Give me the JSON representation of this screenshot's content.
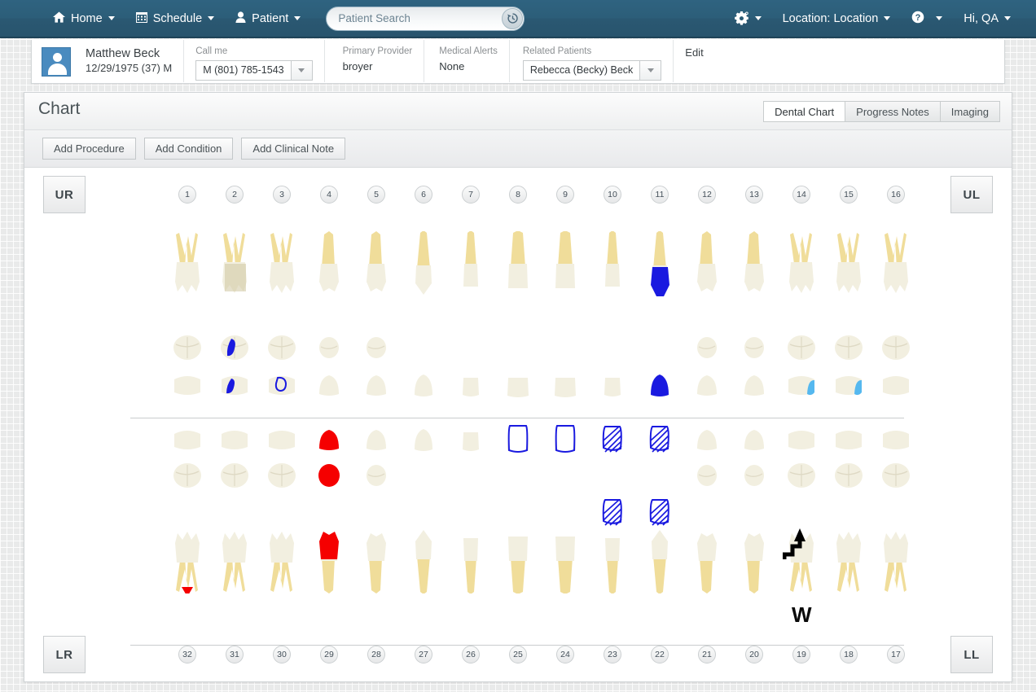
{
  "topnav": {
    "items": [
      {
        "label": "Home",
        "icon": "home-icon",
        "caret": true
      },
      {
        "label": "Schedule",
        "icon": "calendar-icon",
        "caret": true
      },
      {
        "label": "Patient",
        "icon": "person-icon",
        "caret": true
      }
    ],
    "search": {
      "placeholder": "Patient Search",
      "value": "",
      "history_icon": "history-clock-icon"
    },
    "right": {
      "gear_icon": "gear-icon",
      "location_label": "Location: Location",
      "help_icon": "help-circle-icon",
      "user_label": "Hi,  QA"
    },
    "bg_color": "#2b5b75"
  },
  "patient_bar": {
    "avatar_icon": "avatar-icon",
    "name": "Matthew Beck",
    "dob_line": "12/29/1975 (37) M",
    "call_me": {
      "label": "Call me",
      "value": "M (801) 785-1543"
    },
    "primary_provider": {
      "label": "Primary Provider",
      "value": "broyer"
    },
    "medical_alerts": {
      "label": "Medical Alerts",
      "value": "None"
    },
    "related_patients": {
      "label": "Related Patients",
      "value": "Rebecca (Becky) Beck"
    },
    "edit_label": "Edit"
  },
  "chart": {
    "title": "Chart",
    "tabs": [
      {
        "label": "Dental Chart",
        "active": true
      },
      {
        "label": "Progress Notes",
        "active": false
      },
      {
        "label": "Imaging",
        "active": false
      }
    ],
    "toolbar": [
      {
        "label": "Add Procedure"
      },
      {
        "label": "Add Condition"
      },
      {
        "label": "Add Clinical Note"
      }
    ],
    "quadrants": {
      "upper_right": "UR",
      "upper_left": "UL",
      "lower_right": "LR",
      "lower_left": "LL"
    },
    "upper_numbers": [
      1,
      2,
      3,
      4,
      5,
      6,
      7,
      8,
      9,
      10,
      11,
      12,
      13,
      14,
      15,
      16
    ],
    "lower_numbers": [
      32,
      31,
      30,
      29,
      28,
      27,
      26,
      25,
      24,
      23,
      22,
      21,
      20,
      19,
      18,
      17
    ],
    "markers": {
      "w_label": "W",
      "w_tooth": 19,
      "step_arrow_tooth": 19,
      "red_triangle_tooth": 32
    },
    "colors": {
      "filling_blue": "#1a1ae0",
      "outline_blue": "#1a1ae0",
      "sealant_cyan": "#55b8ef",
      "extract_red": "#f50000",
      "enamel": "#f2efe0",
      "root": "#f0dd9a",
      "root_dark": "#e2c878"
    },
    "teeth": [
      {
        "num": 1,
        "arch": "upper",
        "type": "molar3",
        "marks": []
      },
      {
        "num": 2,
        "arch": "upper",
        "type": "molar",
        "marks": [
          "crown-gold",
          "blue-fill-occlusal",
          "blue-fill-facial"
        ]
      },
      {
        "num": 3,
        "arch": "upper",
        "type": "molar",
        "marks": [
          "blue-outline-facial"
        ]
      },
      {
        "num": 4,
        "arch": "upper",
        "type": "premolar",
        "marks": []
      },
      {
        "num": 5,
        "arch": "upper",
        "type": "premolar",
        "marks": []
      },
      {
        "num": 6,
        "arch": "upper",
        "type": "canine",
        "marks": []
      },
      {
        "num": 7,
        "arch": "upper",
        "type": "incisor",
        "marks": []
      },
      {
        "num": 8,
        "arch": "upper",
        "type": "central",
        "marks": []
      },
      {
        "num": 9,
        "arch": "upper",
        "type": "central",
        "marks": []
      },
      {
        "num": 10,
        "arch": "upper",
        "type": "incisor",
        "marks": []
      },
      {
        "num": 11,
        "arch": "upper",
        "type": "canine",
        "marks": [
          "blue-full-crown"
        ]
      },
      {
        "num": 12,
        "arch": "upper",
        "type": "premolar",
        "marks": []
      },
      {
        "num": 13,
        "arch": "upper",
        "type": "premolar",
        "marks": []
      },
      {
        "num": 14,
        "arch": "upper",
        "type": "molar",
        "marks": [
          "cyan-facial"
        ]
      },
      {
        "num": 15,
        "arch": "upper",
        "type": "molar",
        "marks": [
          "cyan-facial"
        ]
      },
      {
        "num": 16,
        "arch": "upper",
        "type": "molar3",
        "marks": []
      },
      {
        "num": 32,
        "arch": "lower",
        "type": "molar3",
        "marks": [
          "red-triangle"
        ]
      },
      {
        "num": 31,
        "arch": "lower",
        "type": "molar",
        "marks": []
      },
      {
        "num": 30,
        "arch": "lower",
        "type": "molar",
        "marks": []
      },
      {
        "num": 29,
        "arch": "lower",
        "type": "premolar",
        "marks": [
          "red-full"
        ]
      },
      {
        "num": 28,
        "arch": "lower",
        "type": "premolar",
        "marks": []
      },
      {
        "num": 27,
        "arch": "lower",
        "type": "canine",
        "marks": []
      },
      {
        "num": 26,
        "arch": "lower",
        "type": "incisor",
        "marks": []
      },
      {
        "num": 25,
        "arch": "lower",
        "type": "central",
        "marks": [
          "blue-outline-crown"
        ]
      },
      {
        "num": 24,
        "arch": "lower",
        "type": "central",
        "marks": [
          "blue-outline-crown"
        ]
      },
      {
        "num": 23,
        "arch": "lower",
        "type": "incisor",
        "marks": [
          "blue-hatch-crown"
        ]
      },
      {
        "num": 22,
        "arch": "lower",
        "type": "canine",
        "marks": [
          "blue-hatch-crown"
        ]
      },
      {
        "num": 21,
        "arch": "lower",
        "type": "premolar",
        "marks": []
      },
      {
        "num": 20,
        "arch": "lower",
        "type": "premolar",
        "marks": []
      },
      {
        "num": 19,
        "arch": "lower",
        "type": "molar",
        "marks": [
          "step-arrow",
          "w-label"
        ]
      },
      {
        "num": 18,
        "arch": "lower",
        "type": "molar",
        "marks": []
      },
      {
        "num": 17,
        "arch": "lower",
        "type": "molar3",
        "marks": []
      }
    ]
  }
}
